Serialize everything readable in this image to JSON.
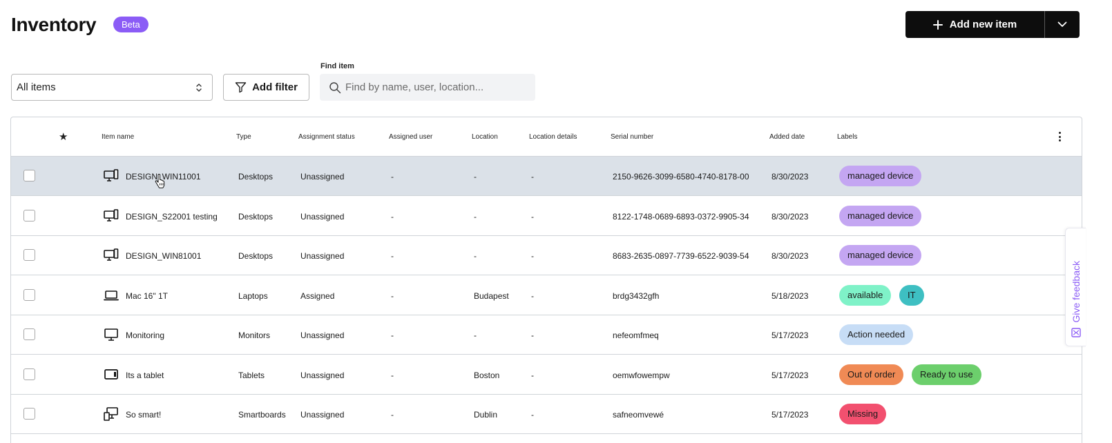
{
  "header": {
    "title": "Inventory",
    "badge": "Beta",
    "add_button_label": "Add new item"
  },
  "toolbar": {
    "view_select_value": "All items",
    "filter_button_label": "Add filter",
    "find_label": "Find item",
    "search_placeholder": "Find by name, user, location..."
  },
  "table": {
    "columns": {
      "item_name": "Item name",
      "type": "Type",
      "assignment_status": "Assignment status",
      "assigned_user": "Assigned user",
      "location": "Location",
      "location_details": "Location details",
      "serial_number": "Serial number",
      "added_date": "Added date",
      "labels": "Labels"
    },
    "rows": [
      {
        "name": "DESIGN_WIN11001",
        "icon": "desktop-icon",
        "type": "Desktops",
        "status": "Unassigned",
        "user": "-",
        "location": "-",
        "location_details": "-",
        "serial": "2150-9626-3099-6580-4740-8178-00",
        "date": "8/30/2023",
        "labels": [
          {
            "text": "managed device",
            "color": "#c4a6f2"
          }
        ],
        "selected": true
      },
      {
        "name": "DESIGN_S22001 testing",
        "icon": "desktop-icon",
        "type": "Desktops",
        "status": "Unassigned",
        "user": "-",
        "location": "-",
        "location_details": "-",
        "serial": "8122-1748-0689-6893-0372-9905-34",
        "date": "8/30/2023",
        "labels": [
          {
            "text": "managed device",
            "color": "#c4a6f2"
          }
        ]
      },
      {
        "name": "DESIGN_WIN81001",
        "icon": "desktop-icon",
        "type": "Desktops",
        "status": "Unassigned",
        "user": "-",
        "location": "-",
        "location_details": "-",
        "serial": "8683-2635-0897-7739-6522-9039-54",
        "date": "8/30/2023",
        "labels": [
          {
            "text": "managed device",
            "color": "#c4a6f2"
          }
        ]
      },
      {
        "name": "Mac 16\" 1T",
        "icon": "laptop-icon",
        "type": "Laptops",
        "status": "Assigned",
        "user": "-",
        "location": "Budapest",
        "location_details": "-",
        "serial": "brdg3432gfh",
        "date": "5/18/2023",
        "labels": [
          {
            "text": "available",
            "color": "#7ff2c8"
          },
          {
            "text": "IT",
            "color": "#3ebfc2"
          }
        ]
      },
      {
        "name": "Monitoring",
        "icon": "monitor-icon",
        "type": "Monitors",
        "status": "Unassigned",
        "user": "-",
        "location": "-",
        "location_details": "-",
        "serial": "nefeomfmeq",
        "date": "5/17/2023",
        "labels": [
          {
            "text": "Action needed",
            "color": "#c7ddf6"
          }
        ]
      },
      {
        "name": "Its a tablet",
        "icon": "tablet-icon",
        "type": "Tablets",
        "status": "Unassigned",
        "user": "-",
        "location": "Boston",
        "location_details": "-",
        "serial": "oemwfowempw",
        "date": "5/17/2023",
        "labels": [
          {
            "text": "Out of order",
            "color": "#f08a55"
          },
          {
            "text": "Ready to use",
            "color": "#6ccf6c"
          }
        ]
      },
      {
        "name": "So smart!",
        "icon": "smartboard-icon",
        "type": "Smartboards",
        "status": "Unassigned",
        "user": "-",
        "location": "Dublin",
        "location_details": "-",
        "serial": "safneomvewé",
        "date": "5/17/2023",
        "labels": [
          {
            "text": "Missing",
            "color": "#f2506f"
          }
        ]
      }
    ]
  },
  "feedback": {
    "label": "Give feedback"
  },
  "colors": {
    "accent": "#8b5cf6",
    "primary_button": "#0d0d0d",
    "selected_row": "#dbe1e8"
  }
}
